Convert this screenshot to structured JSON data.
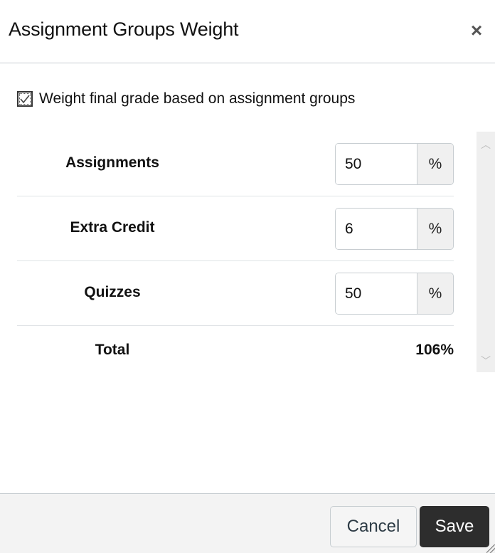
{
  "dialog": {
    "title": "Assignment Groups Weight",
    "close_icon": "×"
  },
  "weight_option": {
    "label": "Weight final grade based on assignment groups",
    "checked": true
  },
  "groups": [
    {
      "name": "Assignments",
      "value": "50",
      "unit": "%"
    },
    {
      "name": "Extra Credit",
      "value": "6",
      "unit": "%"
    },
    {
      "name": "Quizzes",
      "value": "50",
      "unit": "%"
    }
  ],
  "total": {
    "label": "Total",
    "value": "106%"
  },
  "scrollbar": {
    "up_icon": "︿",
    "down_icon": "﹀"
  },
  "footer": {
    "cancel_label": "Cancel",
    "save_label": "Save"
  }
}
